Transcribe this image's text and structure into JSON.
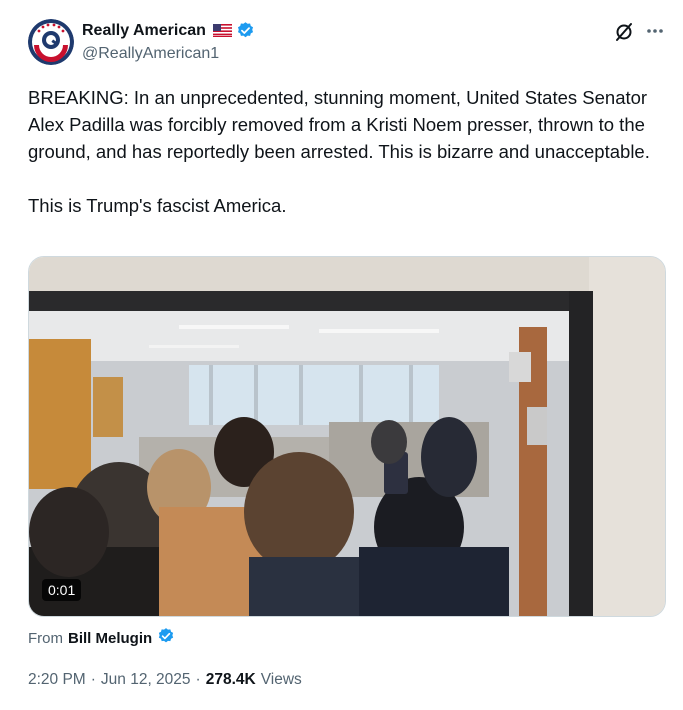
{
  "post": {
    "author": {
      "display_name": "Really American",
      "handle": "@ReallyAmerican1",
      "verified_color": "#1d9bf0"
    },
    "text": "BREAKING: In an unprecedented, stunning moment, United States Senator Alex Padilla was forcibly removed from a Kristi Noem presser, thrown to the ground, and has reportedly been arrested. This is bizarre and unacceptable.\n\nThis is Trump's fascist America.",
    "video": {
      "duration": "0:01"
    },
    "source": {
      "prefix": "From",
      "name": "Bill Melugin"
    },
    "meta": {
      "time": "2:20 PM",
      "separator": "·",
      "date": "Jun 12, 2025",
      "separator2": "·",
      "views_count": "278.4K",
      "views_label": "Views"
    }
  },
  "icons": {
    "header_right": [
      "grok-icon",
      "more-icon"
    ]
  }
}
